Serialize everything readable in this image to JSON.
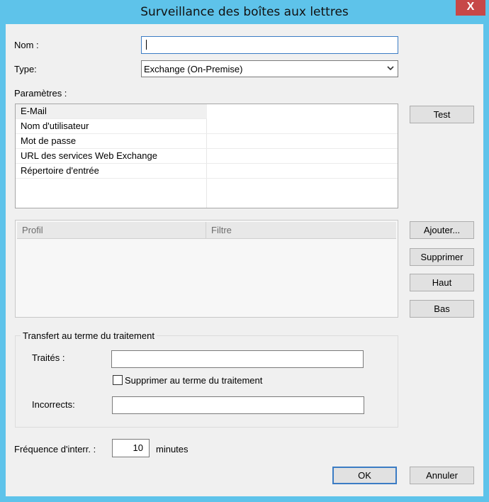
{
  "window": {
    "title": "Surveillance des boîtes aux lettres",
    "close_glyph": "X"
  },
  "form": {
    "name_label": "Nom :",
    "name_value": "",
    "type_label": "Type:",
    "type_value": "Exchange (On-Premise)",
    "params_label": "Paramètres :"
  },
  "params": {
    "rows": [
      {
        "key": "E-Mail",
        "value": ""
      },
      {
        "key": "Nom d'utilisateur",
        "value": ""
      },
      {
        "key": "Mot de passe",
        "value": ""
      },
      {
        "key": "URL des services Web Exchange",
        "value": ""
      },
      {
        "key": "Répertoire d'entrée",
        "value": ""
      }
    ]
  },
  "buttons": {
    "test": "Test",
    "ajouter": "Ajouter...",
    "supprimer": "Supprimer",
    "haut": "Haut",
    "bas": "Bas",
    "ok": "OK",
    "annuler": "Annuler"
  },
  "profiles": {
    "col_profil": "Profil",
    "col_filtre": "Filtre"
  },
  "transfer": {
    "title": "Transfert au terme du traitement",
    "traites_label": "Traités :",
    "traites_value": "",
    "delete_checkbox_label": "Supprimer au terme du traitement",
    "delete_checked": false,
    "incorrects_label": "Incorrects:",
    "incorrects_value": ""
  },
  "frequency": {
    "label": "Fréquence d'interr. :",
    "value": "10",
    "unit": "minutes"
  }
}
